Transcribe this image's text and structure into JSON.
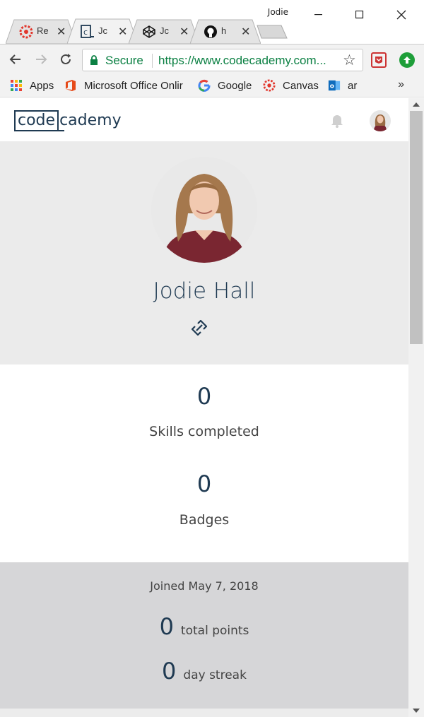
{
  "window": {
    "profile_name": "Jodie",
    "minimize_icon": "minimize-icon",
    "maximize_icon": "maximize-icon",
    "close_icon": "close-icon"
  },
  "tabs": [
    {
      "title": "Re",
      "icon": "canvas-icon",
      "active": false
    },
    {
      "title": "Jc",
      "icon": "codecademy-icon",
      "active": true
    },
    {
      "title": "Jc",
      "icon": "codepen-icon",
      "active": false
    },
    {
      "title": "h",
      "icon": "github-icon",
      "active": false
    }
  ],
  "toolbar": {
    "secure_label": "Secure",
    "url": "https://www.codecademy.com..."
  },
  "bookmarks": [
    {
      "label": "Apps",
      "icon": "apps-grid-icon"
    },
    {
      "label": "Microsoft Office Onlir",
      "icon": "office-icon"
    },
    {
      "label": "Google",
      "icon": "google-icon"
    },
    {
      "label": "Canvas",
      "icon": "canvas-icon"
    },
    {
      "label": "ar",
      "icon": "outlook-icon"
    }
  ],
  "bookmarks_more": "»",
  "site": {
    "logo_box": "code",
    "logo_rest": "cademy",
    "brand_color": "#1f3a52"
  },
  "profile": {
    "name": "Jodie Hall"
  },
  "stats": [
    {
      "value": "0",
      "label": "Skills completed"
    },
    {
      "value": "0",
      "label": "Badges"
    }
  ],
  "details": {
    "joined": "Joined May 7, 2018",
    "points_value": "0",
    "points_label": "total points",
    "streak_value": "0",
    "streak_label": "day streak"
  }
}
